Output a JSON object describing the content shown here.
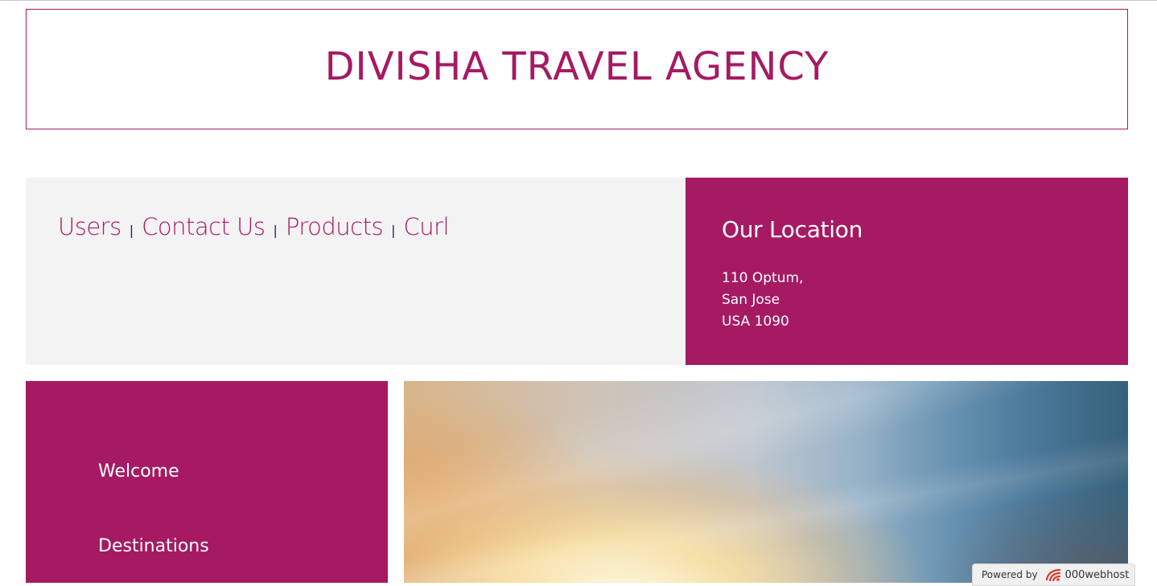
{
  "header": {
    "title": "DIVISHA TRAVEL AGENCY"
  },
  "nav": {
    "links": [
      {
        "label": "Users"
      },
      {
        "label": "Contact Us"
      },
      {
        "label": "Products"
      },
      {
        "label": "Curl"
      }
    ],
    "separator": "|"
  },
  "location": {
    "title": "Our Location",
    "lines": [
      "110 Optum,",
      "San Jose",
      "USA 1090"
    ]
  },
  "sidebar": {
    "items": [
      {
        "label": "Welcome"
      },
      {
        "label": "Destinations"
      }
    ]
  },
  "badge": {
    "powered_by": "Powered by",
    "brand": "000webhost"
  },
  "colors": {
    "brand": "#a51a63",
    "nav_background": "#f3f3f3",
    "separator": "#1a1a6a"
  }
}
